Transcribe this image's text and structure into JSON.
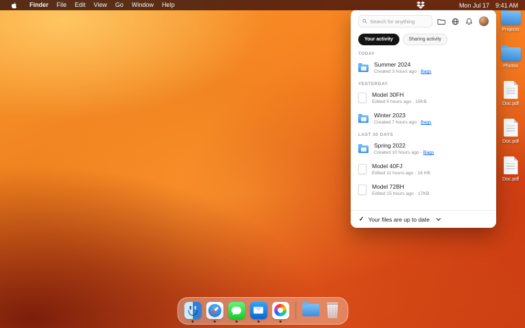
{
  "menu_bar": {
    "items": [
      "Finder",
      "File",
      "Edit",
      "View",
      "Go",
      "Window",
      "Help"
    ],
    "date": "Mon Jul 17",
    "time": "9:41 AM"
  },
  "panel": {
    "search_placeholder": "Search for anything",
    "toolbar_icons": [
      "folder-icon",
      "globe-icon",
      "bell-icon",
      "avatar"
    ],
    "tabs": [
      {
        "label": "Your activity",
        "active": true
      },
      {
        "label": "Sharing activity",
        "active": false
      }
    ],
    "sections": [
      {
        "header": "TODAY",
        "items": [
          {
            "icon": "folder",
            "title": "Summer 2024",
            "meta": "Created 3 hours ago · ",
            "link": "Bags"
          }
        ]
      },
      {
        "header": "YESTERDAY",
        "items": [
          {
            "icon": "file",
            "title": "Model 30FH",
            "meta": "Edited 5 hours ago · 15KB"
          },
          {
            "icon": "folder",
            "title": "Winter 2023",
            "meta": "Created 7 hours ago · ",
            "link": "Bags"
          }
        ]
      },
      {
        "header": "LAST 30 DAYS",
        "items": [
          {
            "icon": "folder",
            "title": "Spring 2022",
            "meta": "Created 10 hours ago · ",
            "link": "Bags"
          },
          {
            "icon": "file",
            "title": "Model 40FJ",
            "meta": "Edited 11 hours ago · 16 KB"
          },
          {
            "icon": "file",
            "title": "Model 72BH",
            "meta": "Edited 15 hours ago · 17KB"
          }
        ]
      }
    ],
    "footer": {
      "check": "✓",
      "status": "Your files are up to date"
    }
  },
  "desktop": {
    "icons": [
      {
        "type": "folder",
        "label": "Projects"
      },
      {
        "type": "folder",
        "label": "Photos"
      },
      {
        "type": "pdf",
        "label": "Doc.pdf"
      },
      {
        "type": "pdf",
        "label": "Doc.pdf"
      },
      {
        "type": "pdf",
        "label": "Doc.pdf"
      }
    ]
  },
  "dock": {
    "items": [
      "finder",
      "safari",
      "messages",
      "mail",
      "photos",
      "folder",
      "trash"
    ]
  },
  "colors": {
    "link_blue": "#0061fe",
    "tab_active_bg": "#141414",
    "folder_blue": "#4b9be8",
    "menubar_tint": "#401309"
  }
}
